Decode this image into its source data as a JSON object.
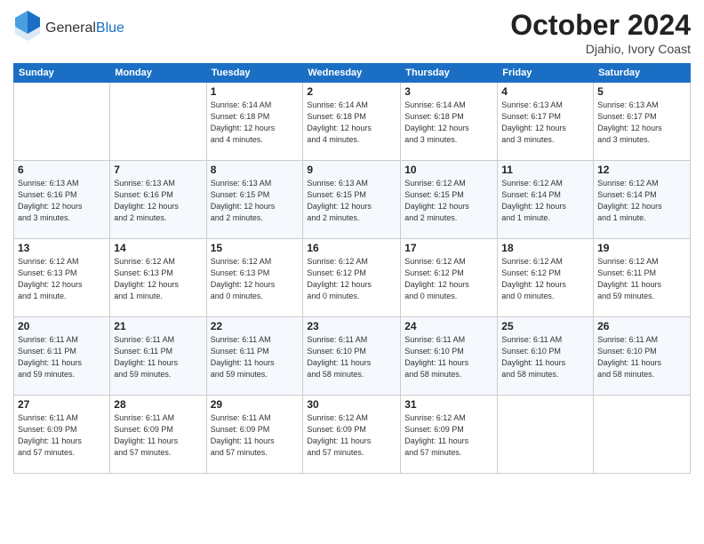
{
  "logo": {
    "general": "General",
    "blue": "Blue"
  },
  "header": {
    "month": "October 2024",
    "location": "Djahio, Ivory Coast"
  },
  "days_of_week": [
    "Sunday",
    "Monday",
    "Tuesday",
    "Wednesday",
    "Thursday",
    "Friday",
    "Saturday"
  ],
  "weeks": [
    [
      {
        "day": "",
        "info": ""
      },
      {
        "day": "",
        "info": ""
      },
      {
        "day": "1",
        "info": "Sunrise: 6:14 AM\nSunset: 6:18 PM\nDaylight: 12 hours\nand 4 minutes."
      },
      {
        "day": "2",
        "info": "Sunrise: 6:14 AM\nSunset: 6:18 PM\nDaylight: 12 hours\nand 4 minutes."
      },
      {
        "day": "3",
        "info": "Sunrise: 6:14 AM\nSunset: 6:18 PM\nDaylight: 12 hours\nand 3 minutes."
      },
      {
        "day": "4",
        "info": "Sunrise: 6:13 AM\nSunset: 6:17 PM\nDaylight: 12 hours\nand 3 minutes."
      },
      {
        "day": "5",
        "info": "Sunrise: 6:13 AM\nSunset: 6:17 PM\nDaylight: 12 hours\nand 3 minutes."
      }
    ],
    [
      {
        "day": "6",
        "info": "Sunrise: 6:13 AM\nSunset: 6:16 PM\nDaylight: 12 hours\nand 3 minutes."
      },
      {
        "day": "7",
        "info": "Sunrise: 6:13 AM\nSunset: 6:16 PM\nDaylight: 12 hours\nand 2 minutes."
      },
      {
        "day": "8",
        "info": "Sunrise: 6:13 AM\nSunset: 6:15 PM\nDaylight: 12 hours\nand 2 minutes."
      },
      {
        "day": "9",
        "info": "Sunrise: 6:13 AM\nSunset: 6:15 PM\nDaylight: 12 hours\nand 2 minutes."
      },
      {
        "day": "10",
        "info": "Sunrise: 6:12 AM\nSunset: 6:15 PM\nDaylight: 12 hours\nand 2 minutes."
      },
      {
        "day": "11",
        "info": "Sunrise: 6:12 AM\nSunset: 6:14 PM\nDaylight: 12 hours\nand 1 minute."
      },
      {
        "day": "12",
        "info": "Sunrise: 6:12 AM\nSunset: 6:14 PM\nDaylight: 12 hours\nand 1 minute."
      }
    ],
    [
      {
        "day": "13",
        "info": "Sunrise: 6:12 AM\nSunset: 6:13 PM\nDaylight: 12 hours\nand 1 minute."
      },
      {
        "day": "14",
        "info": "Sunrise: 6:12 AM\nSunset: 6:13 PM\nDaylight: 12 hours\nand 1 minute."
      },
      {
        "day": "15",
        "info": "Sunrise: 6:12 AM\nSunset: 6:13 PM\nDaylight: 12 hours\nand 0 minutes."
      },
      {
        "day": "16",
        "info": "Sunrise: 6:12 AM\nSunset: 6:12 PM\nDaylight: 12 hours\nand 0 minutes."
      },
      {
        "day": "17",
        "info": "Sunrise: 6:12 AM\nSunset: 6:12 PM\nDaylight: 12 hours\nand 0 minutes."
      },
      {
        "day": "18",
        "info": "Sunrise: 6:12 AM\nSunset: 6:12 PM\nDaylight: 12 hours\nand 0 minutes."
      },
      {
        "day": "19",
        "info": "Sunrise: 6:12 AM\nSunset: 6:11 PM\nDaylight: 11 hours\nand 59 minutes."
      }
    ],
    [
      {
        "day": "20",
        "info": "Sunrise: 6:11 AM\nSunset: 6:11 PM\nDaylight: 11 hours\nand 59 minutes."
      },
      {
        "day": "21",
        "info": "Sunrise: 6:11 AM\nSunset: 6:11 PM\nDaylight: 11 hours\nand 59 minutes."
      },
      {
        "day": "22",
        "info": "Sunrise: 6:11 AM\nSunset: 6:11 PM\nDaylight: 11 hours\nand 59 minutes."
      },
      {
        "day": "23",
        "info": "Sunrise: 6:11 AM\nSunset: 6:10 PM\nDaylight: 11 hours\nand 58 minutes."
      },
      {
        "day": "24",
        "info": "Sunrise: 6:11 AM\nSunset: 6:10 PM\nDaylight: 11 hours\nand 58 minutes."
      },
      {
        "day": "25",
        "info": "Sunrise: 6:11 AM\nSunset: 6:10 PM\nDaylight: 11 hours\nand 58 minutes."
      },
      {
        "day": "26",
        "info": "Sunrise: 6:11 AM\nSunset: 6:10 PM\nDaylight: 11 hours\nand 58 minutes."
      }
    ],
    [
      {
        "day": "27",
        "info": "Sunrise: 6:11 AM\nSunset: 6:09 PM\nDaylight: 11 hours\nand 57 minutes."
      },
      {
        "day": "28",
        "info": "Sunrise: 6:11 AM\nSunset: 6:09 PM\nDaylight: 11 hours\nand 57 minutes."
      },
      {
        "day": "29",
        "info": "Sunrise: 6:11 AM\nSunset: 6:09 PM\nDaylight: 11 hours\nand 57 minutes."
      },
      {
        "day": "30",
        "info": "Sunrise: 6:12 AM\nSunset: 6:09 PM\nDaylight: 11 hours\nand 57 minutes."
      },
      {
        "day": "31",
        "info": "Sunrise: 6:12 AM\nSunset: 6:09 PM\nDaylight: 11 hours\nand 57 minutes."
      },
      {
        "day": "",
        "info": ""
      },
      {
        "day": "",
        "info": ""
      }
    ]
  ]
}
